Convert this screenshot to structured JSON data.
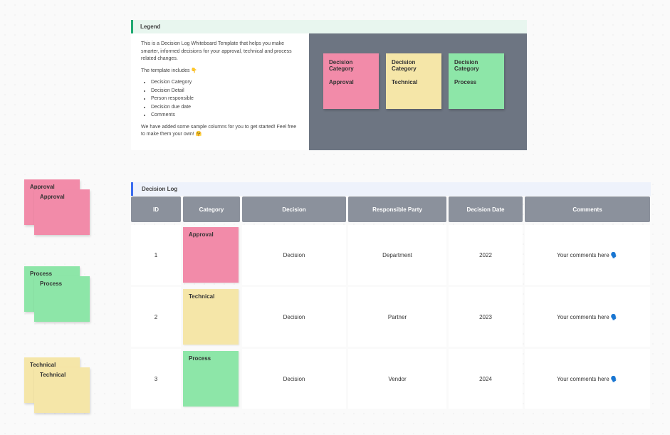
{
  "legend": {
    "title": "Legend",
    "intro": "This is a Decision Log Whiteboard Template that helps you make smarter, informed decisions for your approval, technical and process related changes.",
    "includes_label": "The template includes 👇",
    "bullets": [
      "Decision Category",
      "Decision Detail",
      "Person responsible",
      "Decision due date",
      "Comments"
    ],
    "outro": "We have added some sample columns for you to get started! Feel free to make them your own! 🤗",
    "cards": [
      {
        "heading": "Decision Category",
        "label": "Approval",
        "color": "pink"
      },
      {
        "heading": "Decision Category",
        "label": "Technical",
        "color": "yellow"
      },
      {
        "heading": "Decision Category",
        "label": "Process",
        "color": "green"
      }
    ]
  },
  "sidebar": {
    "stacks": [
      {
        "label": "Approval",
        "color": "pink"
      },
      {
        "label": "Process",
        "color": "green"
      },
      {
        "label": "Technical",
        "color": "yellow"
      }
    ]
  },
  "log": {
    "title": "Decision Log",
    "headers": {
      "id": "ID",
      "category": "Category",
      "decision": "Decision",
      "responsible": "Responsible Party",
      "date": "Decision Date",
      "comments": "Comments"
    },
    "rows": [
      {
        "id": "1",
        "category": "Approval",
        "cat_color": "pink",
        "decision": "Decision",
        "responsible": "Department",
        "date": "2022",
        "comments": "Your comments here 🗣️"
      },
      {
        "id": "2",
        "category": "Technical",
        "cat_color": "yellow",
        "decision": "Decision",
        "responsible": "Partner",
        "date": "2023",
        "comments": "Your comments here 🗣️"
      },
      {
        "id": "3",
        "category": "Process",
        "cat_color": "green",
        "decision": "Decision",
        "responsible": "Vendor",
        "date": "2024",
        "comments": "Your comments here 🗣️"
      }
    ]
  },
  "colors": {
    "pink": "#f28ba9",
    "yellow": "#f5e6a8",
    "green": "#8de6a8"
  }
}
